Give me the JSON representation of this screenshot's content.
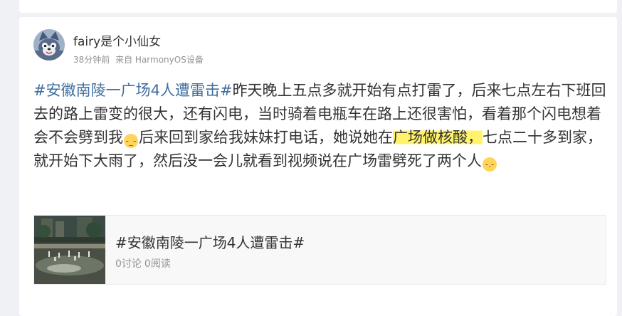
{
  "post": {
    "username": "fairy是个小仙女",
    "time": "38分钟前",
    "source": "来自 HarmonyOS设备",
    "body": {
      "hashtag": "#安徽南陵一广场4人遭雷击#",
      "part1": "昨天晚上五点多就开始有点打雷了，后来七点左右下班回去的路上雷变的很大，还有闪电，当时骑着电瓶车在路上还很害怕，看着那个闪电想着会不会劈到我",
      "emoji1": "sleepy-emoji",
      "part2": "后来回到家给我妹妹打电话，她说她在",
      "highlight": "广场做核酸，",
      "part3": "七点二十多到家，就开始下大雨了，然后没一会儿就看到视频说在广场雷劈死了两个人",
      "emoji2": "sweat-emoji"
    },
    "topic_card": {
      "title": "#安徽南陵一广场4人遭雷击#",
      "discussions": "0讨论",
      "reads": "0阅读"
    }
  },
  "colors": {
    "link": "#3f6ea0",
    "highlight": "#fff36b",
    "meta": "#939393"
  }
}
